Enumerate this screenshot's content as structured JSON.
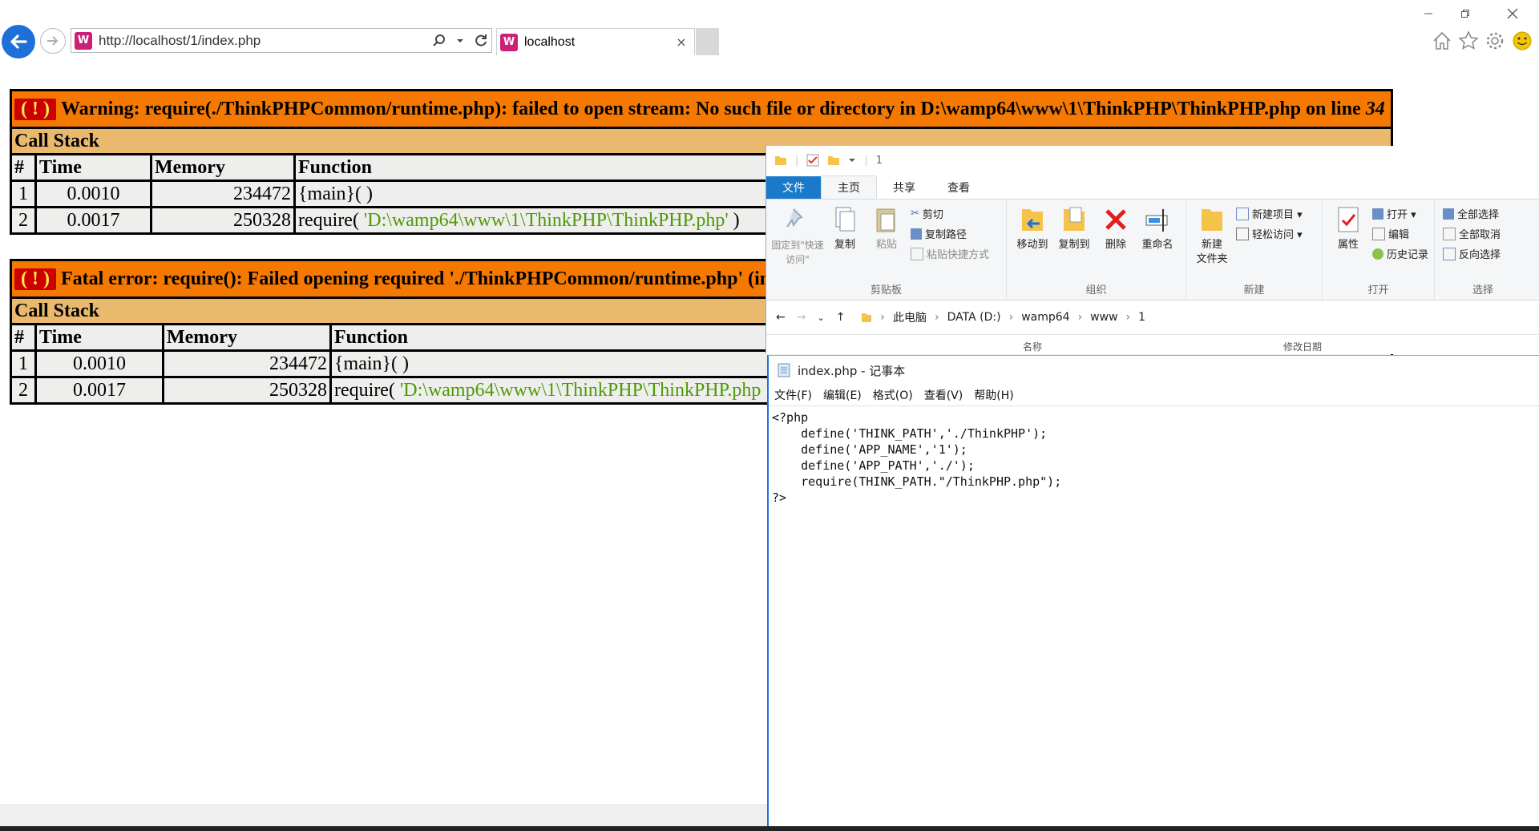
{
  "browser": {
    "url": "http://localhost/1/index.php",
    "tab_title": "localhost",
    "tab_close": "×",
    "site_icon": "W",
    "icons": [
      "back-icon",
      "forward-icon",
      "search-icon",
      "refresh-icon",
      "home-icon",
      "favorites-star-icon",
      "settings-gear-icon",
      "smiley-feedback-icon"
    ]
  },
  "errors": [
    {
      "bang": "( ! )",
      "message": "Warning: require(./ThinkPHPCommon/runtime.php): failed to open stream: No such file or directory in D:\\wamp64\\www\\1\\ThinkPHP\\ThinkPHP.php on line ",
      "line": "34",
      "call_stack": "Call Stack",
      "headers": [
        "#",
        "Time",
        "Memory",
        "Function"
      ],
      "rows": [
        {
          "n": "1",
          "time": "0.0010",
          "memory": "234472",
          "fn": "{main}( )",
          "arg": "",
          "tail": ""
        },
        {
          "n": "2",
          "time": "0.0017",
          "memory": "250328",
          "fn": "require( ",
          "arg": "'D:\\wamp64\\www\\1\\ThinkPHP\\ThinkPHP.php'",
          "tail": " )"
        }
      ]
    },
    {
      "bang": "( ! )",
      "message": "Fatal error: require(): Failed opening required './ThinkPHPCommon/runtime.php' (in",
      "line": "",
      "call_stack": "Call Stack",
      "headers": [
        "#",
        "Time",
        "Memory",
        "Function"
      ],
      "rows": [
        {
          "n": "1",
          "time": "0.0010",
          "memory": "234472",
          "fn": "{main}( )",
          "arg": "",
          "tail": ""
        },
        {
          "n": "2",
          "time": "0.0017",
          "memory": "250328",
          "fn": "require( ",
          "arg": "'D:\\wamp64\\www\\1\\ThinkPHP\\ThinkPHP.php",
          "tail": ""
        }
      ]
    }
  ],
  "explorer": {
    "qa_title": "1",
    "tabs": [
      "文件",
      "主页",
      "共享",
      "查看"
    ],
    "groups": {
      "clipboard": {
        "title": "剪贴板",
        "pin_quick": "固定到\"快速访问\"",
        "copy": "复制",
        "paste": "粘贴",
        "cut": "剪切",
        "copy_path": "复制路径",
        "paste_shortcut": "粘贴快捷方式"
      },
      "organize": {
        "title": "组织",
        "move_to": "移动到",
        "copy_to": "复制到",
        "delete": "删除",
        "rename": "重命名"
      },
      "new": {
        "title": "新建",
        "new_folder": "新建\n文件夹",
        "new_item": "新建项目 ▾",
        "easy_access": "轻松访问 ▾"
      },
      "open": {
        "title": "打开",
        "properties": "属性",
        "open": "打开 ▾",
        "edit": "编辑",
        "history": "历史记录"
      },
      "select": {
        "title": "选择",
        "select_all": "全部选择",
        "select_none": "全部取消",
        "invert": "反向选择"
      }
    },
    "breadcrumb": [
      "此电脑",
      "DATA (D:)",
      "wamp64",
      "www",
      "1"
    ],
    "col_name": "名称",
    "col_modified": "修改日期"
  },
  "notepad": {
    "title": "index.php - 记事本",
    "menu": [
      "文件(F)",
      "编辑(E)",
      "格式(O)",
      "查看(V)",
      "帮助(H)"
    ],
    "content": "<?php\n    define('THINK_PATH','./ThinkPHP');\n    define('APP_NAME','1');\n    define('APP_PATH','./');\n    require(THINK_PATH.\"/ThinkPHP.php\");\n?>"
  },
  "colors": {
    "error_header": "#f57900",
    "call_stack_header": "#e9b96e",
    "bang_bg": "#cc0000",
    "arg_green": "#4e9a06",
    "ribbon_file_tab": "#1979ca"
  }
}
